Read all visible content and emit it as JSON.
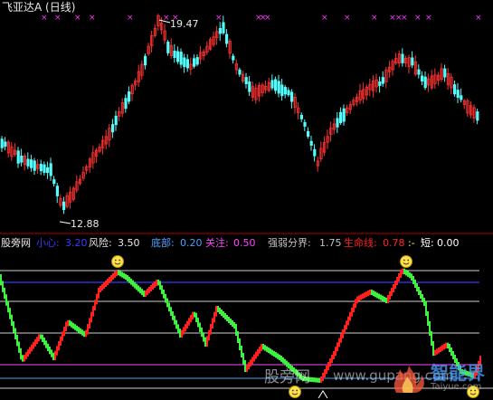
{
  "window": {
    "title": "飞亚达A (日线)"
  },
  "price_panel": {
    "high_label": "19.47",
    "low_label": "12.88",
    "colors": {
      "up": "#ff3232",
      "down": "#54fcfc",
      "marker": "#ff33ff"
    }
  },
  "indicator_bar": {
    "name": "股旁网",
    "items": [
      {
        "label": "小心:",
        "value": "3.20",
        "color": "#3a3aff"
      },
      {
        "label": "风险:",
        "value": "3.50",
        "color": "#e8e8e8"
      },
      {
        "label": "底部:",
        "value": "0.20",
        "color": "#4aa0ff"
      },
      {
        "label": "关注:",
        "value": "0.50",
        "color": "#ff44ff"
      },
      {
        "label": "强弱分界:",
        "value": "1.75",
        "color": "#c0c0c0"
      },
      {
        "label": "生命线:",
        "value": "0.78",
        "color": "#ff2020"
      },
      {
        "label": ":-",
        "value": "",
        "color": "#ffff40"
      },
      {
        "label": "短:",
        "value": "0.00",
        "color": "#ffffff"
      }
    ]
  },
  "watermarks": {
    "cn": "股旁网",
    "url": "www.gupang.com",
    "brand": "智能界",
    "brand_url": "Taiyue.com"
  }
}
